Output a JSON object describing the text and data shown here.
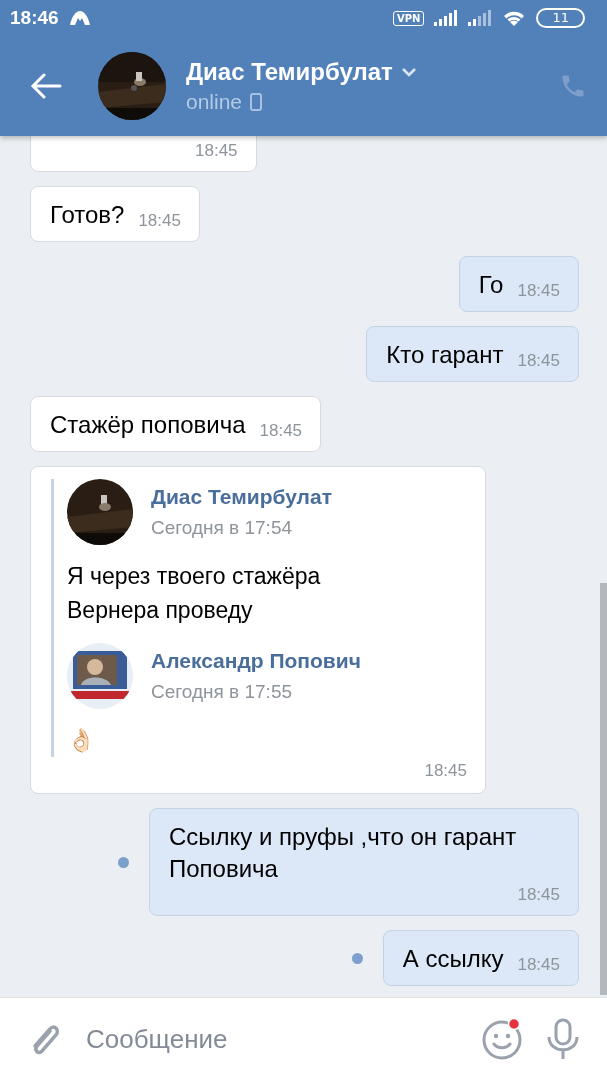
{
  "status_bar": {
    "time": "18:46",
    "vpn": "VPN",
    "battery": "11"
  },
  "header": {
    "name": "Диас Темирбулат",
    "status": "online"
  },
  "messages": [
    {
      "kind": "in",
      "time": "18:45"
    },
    {
      "kind": "in",
      "text": "Готов?",
      "time": "18:45"
    },
    {
      "kind": "out",
      "text": "Го",
      "time": "18:45",
      "unread": false
    },
    {
      "kind": "out",
      "text": "Кто гарант",
      "time": "18:45",
      "unread": false
    },
    {
      "kind": "in",
      "text": "Стажёр поповича",
      "time": "18:45"
    },
    {
      "kind": "forward",
      "time": "18:45",
      "items": [
        {
          "author": "Диас Темирбулат",
          "date": "Сегодня в 17:54",
          "text": "Я через твоего стажёра Вернера проведу"
        },
        {
          "author": "Александр Попович",
          "date": "Сегодня в 17:55",
          "text": "👌🏻"
        }
      ]
    },
    {
      "kind": "out",
      "text": "Ссылку и пруфы ,что он гарант Поповича",
      "time": "18:45",
      "unread": true
    },
    {
      "kind": "out",
      "text": "А ссылку",
      "time": "18:45",
      "unread": true
    }
  ],
  "composer": {
    "placeholder": "Сообщение",
    "emoji_badge": true
  }
}
